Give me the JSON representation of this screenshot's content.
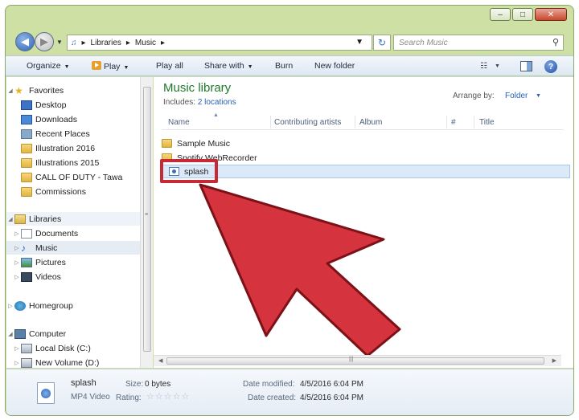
{
  "address": {
    "crumbs": [
      "Libraries",
      "Music"
    ],
    "search_placeholder": "Search Music"
  },
  "toolbar": {
    "organize": "Organize",
    "play": "Play",
    "play_all": "Play all",
    "share_with": "Share with",
    "burn": "Burn",
    "new_folder": "New folder"
  },
  "nav": {
    "favorites": "Favorites",
    "favorites_items": [
      "Desktop",
      "Downloads",
      "Recent Places",
      "Illustration 2016",
      "Illustrations 2015",
      "CALL OF DUTY - Tawa",
      "Commissions"
    ],
    "libraries": "Libraries",
    "library_items": [
      "Documents",
      "Music",
      "Pictures",
      "Videos"
    ],
    "homegroup": "Homegroup",
    "computer": "Computer",
    "computer_items": [
      "Local Disk (C:)",
      "New Volume (D:)"
    ]
  },
  "content": {
    "title": "Music library",
    "includes_label": "Includes:",
    "includes_link": "2 locations",
    "arrange_label": "Arrange by:",
    "arrange_value": "Folder",
    "columns": [
      "Name",
      "Contributing artists",
      "Album",
      "#",
      "Title"
    ],
    "rows": [
      "Sample Music",
      "Spotify WebRecorder",
      "splash"
    ]
  },
  "details": {
    "name": "splash",
    "type": "MP4 Video",
    "size_label": "Size:",
    "size_value": "0 bytes",
    "rating_label": "Rating:",
    "rating_stars": 0,
    "modified_label": "Date modified:",
    "modified_value": "4/5/2016 6:04 PM",
    "created_label": "Date created:",
    "created_value": "4/5/2016 6:04 PM"
  },
  "colors": {
    "library_title": "#1e7a2a",
    "link": "#2a5fb5",
    "highlight_box": "#c62a35",
    "arrow_fill": "#d5333e",
    "window_frame": "#cfe0a4"
  }
}
